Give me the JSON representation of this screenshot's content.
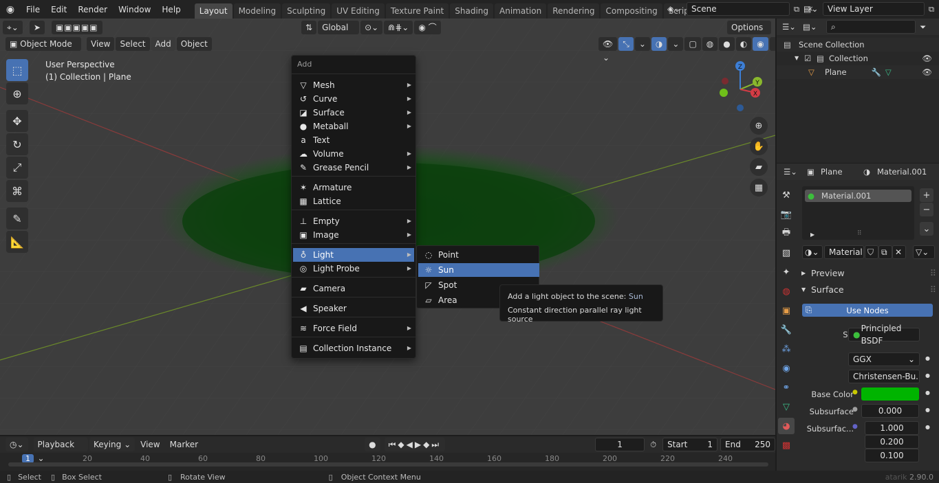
{
  "topbar": {
    "menus": [
      "File",
      "Edit",
      "Render",
      "Window",
      "Help"
    ],
    "workspaces": [
      "Layout",
      "Modeling",
      "Sculpting",
      "UV Editing",
      "Texture Paint",
      "Shading",
      "Animation",
      "Rendering",
      "Compositing",
      "Scripting"
    ],
    "active_workspace": "Layout",
    "add_workspace": "+",
    "scene_name": "Scene",
    "view_layer": "View Layer"
  },
  "viewport_header": {
    "orientation": "Global",
    "options": "Options",
    "mode": "Object Mode",
    "menus": [
      "View",
      "Select",
      "Add",
      "Object"
    ]
  },
  "viewport": {
    "perspective": "User Perspective",
    "collection_info": "(1) Collection | Plane",
    "gizmo": {
      "z": "Z",
      "y": "Y",
      "x": "X"
    }
  },
  "add_menu": {
    "title": "Add",
    "items": [
      {
        "label": "Mesh",
        "icon": "mesh-icon",
        "glyph": "▽",
        "sub": true
      },
      {
        "label": "Curve",
        "icon": "curve-icon",
        "glyph": "↺",
        "sub": true
      },
      {
        "label": "Surface",
        "icon": "surface-icon",
        "glyph": "◪",
        "sub": true
      },
      {
        "label": "Metaball",
        "icon": "metaball-icon",
        "glyph": "●",
        "sub": true
      },
      {
        "label": "Text",
        "icon": "text-icon",
        "glyph": "a",
        "sub": false
      },
      {
        "label": "Volume",
        "icon": "volume-icon",
        "glyph": "☁",
        "sub": true
      },
      {
        "label": "Grease Pencil",
        "icon": "grease-pencil-icon",
        "glyph": "✎",
        "sub": true
      },
      {
        "label": "Armature",
        "icon": "armature-icon",
        "glyph": "✶",
        "sub": false
      },
      {
        "label": "Lattice",
        "icon": "lattice-icon",
        "glyph": "▦",
        "sub": false
      },
      {
        "label": "Empty",
        "icon": "empty-icon",
        "glyph": "⊥",
        "sub": true
      },
      {
        "label": "Image",
        "icon": "image-icon",
        "glyph": "▣",
        "sub": true
      },
      {
        "label": "Light",
        "icon": "light-icon",
        "glyph": "♁",
        "sub": true
      },
      {
        "label": "Light Probe",
        "icon": "light-probe-icon",
        "glyph": "◎",
        "sub": true
      },
      {
        "label": "Camera",
        "icon": "camera-icon",
        "glyph": "▰",
        "sub": false
      },
      {
        "label": "Speaker",
        "icon": "speaker-icon",
        "glyph": "◀",
        "sub": false
      },
      {
        "label": "Force Field",
        "icon": "force-field-icon",
        "glyph": "≋",
        "sub": true
      },
      {
        "label": "Collection Instance",
        "icon": "collection-instance-icon",
        "glyph": "▤",
        "sub": true
      }
    ]
  },
  "light_submenu": {
    "items": [
      {
        "label": "Point",
        "icon": "point-light-icon",
        "glyph": "◌"
      },
      {
        "label": "Sun",
        "icon": "sun-light-icon",
        "glyph": "☼"
      },
      {
        "label": "Spot",
        "icon": "spot-light-icon",
        "glyph": "◸"
      },
      {
        "label": "Area",
        "icon": "area-light-icon",
        "glyph": "▱"
      }
    ],
    "highlighted": "Sun"
  },
  "tooltip": {
    "line1": "Add a light object to the scene:",
    "value": "Sun",
    "line2": "Constant direction parallel ray light source"
  },
  "outliner": {
    "scene_collection": "Scene Collection",
    "collection": "Collection",
    "object": "Plane"
  },
  "properties": {
    "object": "Plane",
    "material_header": "Material.001",
    "slot": "Material.001",
    "material_field": "Material...",
    "preview": "Preview",
    "surface_section": "Surface",
    "use_nodes": "Use Nodes",
    "surface_label": "Surface",
    "surface_value": "Principled BSDF",
    "distribution": "GGX",
    "subsurface_method": "Christensen-Bu...",
    "base_color_label": "Base Color",
    "subsurface_label": "Subsurface",
    "subsurface_value": "0.000",
    "subsurface_radius_label": "Subsurfac...",
    "radius": [
      "1.000",
      "0.200",
      "0.100"
    ],
    "colors": {
      "base_color": "#00b400",
      "highlight": "#4772b3"
    }
  },
  "timeline": {
    "menus": [
      "Playback",
      "Keying",
      "View",
      "Marker"
    ],
    "current_frame": "1",
    "start_label": "Start",
    "start": "1",
    "end_label": "End",
    "end": "250",
    "ruler": [
      "1",
      "20",
      "40",
      "60",
      "80",
      "100",
      "120",
      "140",
      "160",
      "180",
      "200",
      "220",
      "240"
    ]
  },
  "statusbar": {
    "select": "Select",
    "box_select": "Box Select",
    "rotate_view": "Rotate View",
    "context_menu": "Object Context Menu",
    "version": "2.90.0"
  },
  "watermark": "atarik"
}
